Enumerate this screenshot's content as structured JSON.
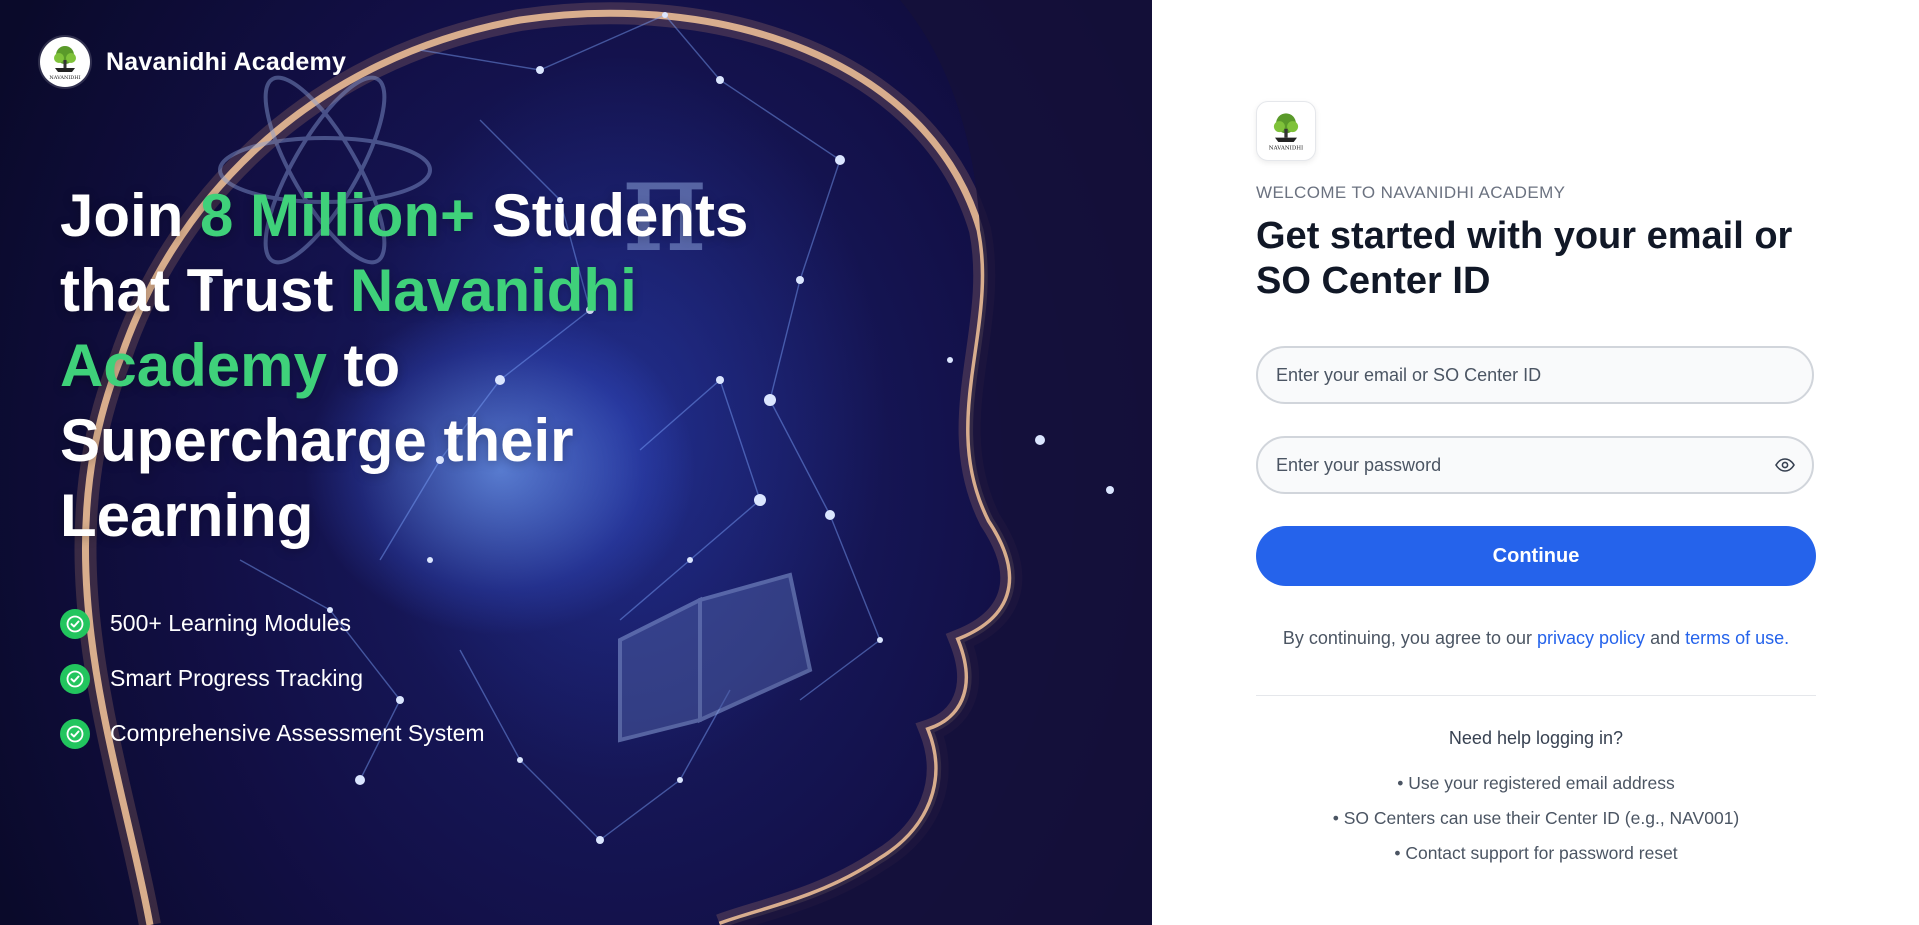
{
  "brand": {
    "name": "Navanidhi Academy",
    "logo_text": "NAVANIDHI"
  },
  "hero": {
    "headline": {
      "part1": "Join ",
      "accent1": "8 Million+",
      "part2": " Students that Trust ",
      "accent2": "Navanidhi Academy",
      "part3": " to Supercharge their Learning"
    },
    "features": [
      {
        "label": "500+ Learning Modules",
        "icon": "check-circle-icon"
      },
      {
        "label": "Smart Progress Tracking",
        "icon": "check-circle-icon"
      },
      {
        "label": "Comprehensive Assessment System",
        "icon": "check-circle-icon"
      }
    ]
  },
  "login": {
    "eyebrow": "WELCOME TO NAVANIDHI ACADEMY",
    "title": "Get started with your email or SO Center ID",
    "email_placeholder": "Enter your email or SO Center ID",
    "password_placeholder": "Enter your password",
    "password_toggle_icon": "eye-icon",
    "continue_label": "Continue",
    "terms_prefix": "By continuing, you agree to our ",
    "privacy_link": "privacy policy",
    "terms_middle": " and ",
    "terms_link": "terms of use.",
    "help_title": "Need help logging in?",
    "help_items": [
      "• Use your registered email address",
      "• SO Centers can use their Center ID (e.g., NAV001)",
      "• Contact support for password reset"
    ]
  },
  "colors": {
    "accent_green": "#3fd17a",
    "primary_blue": "#2563eb",
    "hero_bg": "#120f45"
  }
}
